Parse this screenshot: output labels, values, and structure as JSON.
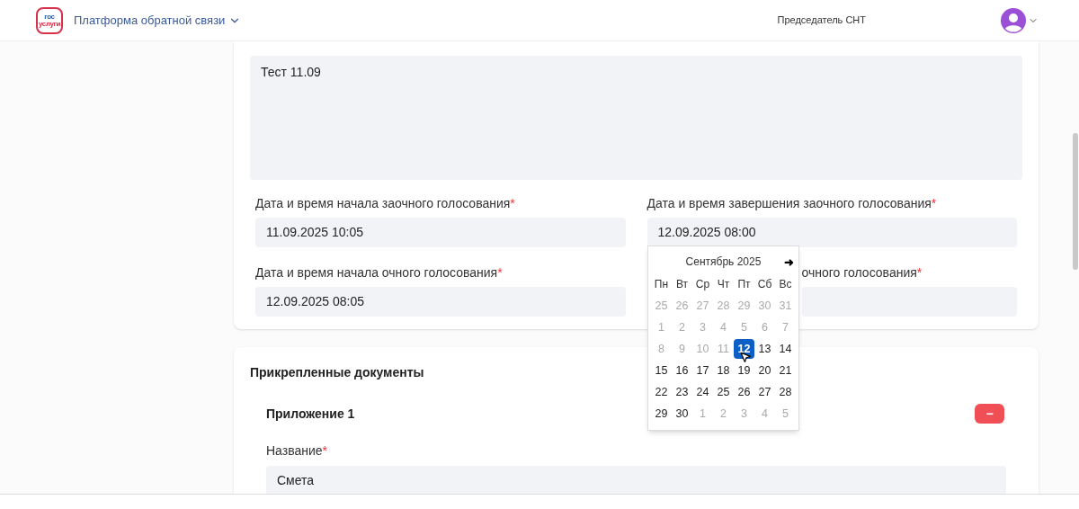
{
  "header": {
    "logo": [
      "гос",
      "услуги"
    ],
    "product": "Платформа обратной связи",
    "role": "Председатель СНТ"
  },
  "form": {
    "description": "Тест 11.09",
    "required_mark": "*",
    "fields": [
      {
        "label": "Дата и время начала заочного голосования",
        "required": true,
        "value": "11.09.2025 10:05"
      },
      {
        "label": "Дата и время завершения заочного голосования",
        "required": true,
        "value": "12.09.2025 08:00"
      },
      {
        "label": "Дата и время начала очного голосования",
        "required": true,
        "value": "12.09.2025 08:05"
      },
      {
        "label": "очного голосования",
        "required": true
      }
    ]
  },
  "calendar": {
    "month": "Сентябрь 2025",
    "next": "➜",
    "weekdays": [
      "Пн",
      "Вт",
      "Ср",
      "Чт",
      "Пт",
      "Сб",
      "Вс"
    ],
    "days": [
      {
        "label": "25",
        "muted": true,
        "selected": false
      },
      {
        "label": "26",
        "muted": true,
        "selected": false
      },
      {
        "label": "27",
        "muted": true,
        "selected": false
      },
      {
        "label": "28",
        "muted": true,
        "selected": false
      },
      {
        "label": "29",
        "muted": true,
        "selected": false
      },
      {
        "label": "30",
        "muted": true,
        "selected": false
      },
      {
        "label": "31",
        "muted": true,
        "selected": false
      },
      {
        "label": "1",
        "muted": true,
        "selected": false
      },
      {
        "label": "2",
        "muted": true,
        "selected": false
      },
      {
        "label": "3",
        "muted": true,
        "selected": false
      },
      {
        "label": "4",
        "muted": true,
        "selected": false
      },
      {
        "label": "5",
        "muted": true,
        "selected": false
      },
      {
        "label": "6",
        "muted": true,
        "selected": false
      },
      {
        "label": "7",
        "muted": true,
        "selected": false
      },
      {
        "label": "8",
        "muted": true,
        "selected": false
      },
      {
        "label": "9",
        "muted": true,
        "selected": false
      },
      {
        "label": "10",
        "muted": true,
        "selected": false
      },
      {
        "label": "11",
        "muted": true,
        "selected": false
      },
      {
        "label": "12",
        "muted": false,
        "selected": true
      },
      {
        "label": "13",
        "muted": false,
        "selected": false
      },
      {
        "label": "14",
        "muted": false,
        "selected": false
      },
      {
        "label": "15",
        "muted": false,
        "selected": false
      },
      {
        "label": "16",
        "muted": false,
        "selected": false
      },
      {
        "label": "17",
        "muted": false,
        "selected": false
      },
      {
        "label": "18",
        "muted": false,
        "selected": false
      },
      {
        "label": "19",
        "muted": false,
        "selected": false
      },
      {
        "label": "20",
        "muted": false,
        "selected": false
      },
      {
        "label": "21",
        "muted": false,
        "selected": false
      },
      {
        "label": "22",
        "muted": false,
        "selected": false
      },
      {
        "label": "23",
        "muted": false,
        "selected": false
      },
      {
        "label": "24",
        "muted": false,
        "selected": false
      },
      {
        "label": "25",
        "muted": false,
        "selected": false
      },
      {
        "label": "26",
        "muted": false,
        "selected": false
      },
      {
        "label": "27",
        "muted": false,
        "selected": false
      },
      {
        "label": "28",
        "muted": false,
        "selected": false
      },
      {
        "label": "29",
        "muted": false,
        "selected": false
      },
      {
        "label": "30",
        "muted": false,
        "selected": false
      },
      {
        "label": "1",
        "muted": true,
        "selected": false
      },
      {
        "label": "2",
        "muted": true,
        "selected": false
      },
      {
        "label": "3",
        "muted": true,
        "selected": false
      },
      {
        "label": "4",
        "muted": true,
        "selected": false
      },
      {
        "label": "5",
        "muted": true,
        "selected": false
      }
    ]
  },
  "documents": {
    "title": "Прикрепленные документы",
    "items": [
      {
        "title": "Приложение 1",
        "remove": "−",
        "name_label": "Название",
        "required": true,
        "name": "Смета"
      }
    ]
  }
}
